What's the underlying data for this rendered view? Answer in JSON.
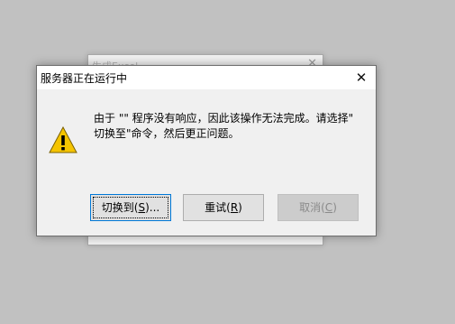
{
  "background_window": {
    "title": "生成Excel",
    "close_glyph": "✕"
  },
  "dialog": {
    "title": "服务器正在运行中",
    "close_glyph": "✕",
    "icon": "warning-icon",
    "message_line1": "由于 \"\" 程序没有响应，因此该操作无法完成。请选择\"",
    "message_line2": "切换至\"命令，然后更正问题。",
    "buttons": [
      {
        "label": "切换到(",
        "mnemonic": "S",
        "suffix": ")...",
        "enabled": true,
        "default": true
      },
      {
        "label": "重试(",
        "mnemonic": "R",
        "suffix": ")",
        "enabled": true,
        "default": false
      },
      {
        "label": "取消(",
        "mnemonic": "C",
        "suffix": ")",
        "enabled": false,
        "default": false
      }
    ]
  },
  "colors": {
    "desktop": "#c1c1c1",
    "accent": "#0078d7",
    "warning": "#f5c400"
  }
}
